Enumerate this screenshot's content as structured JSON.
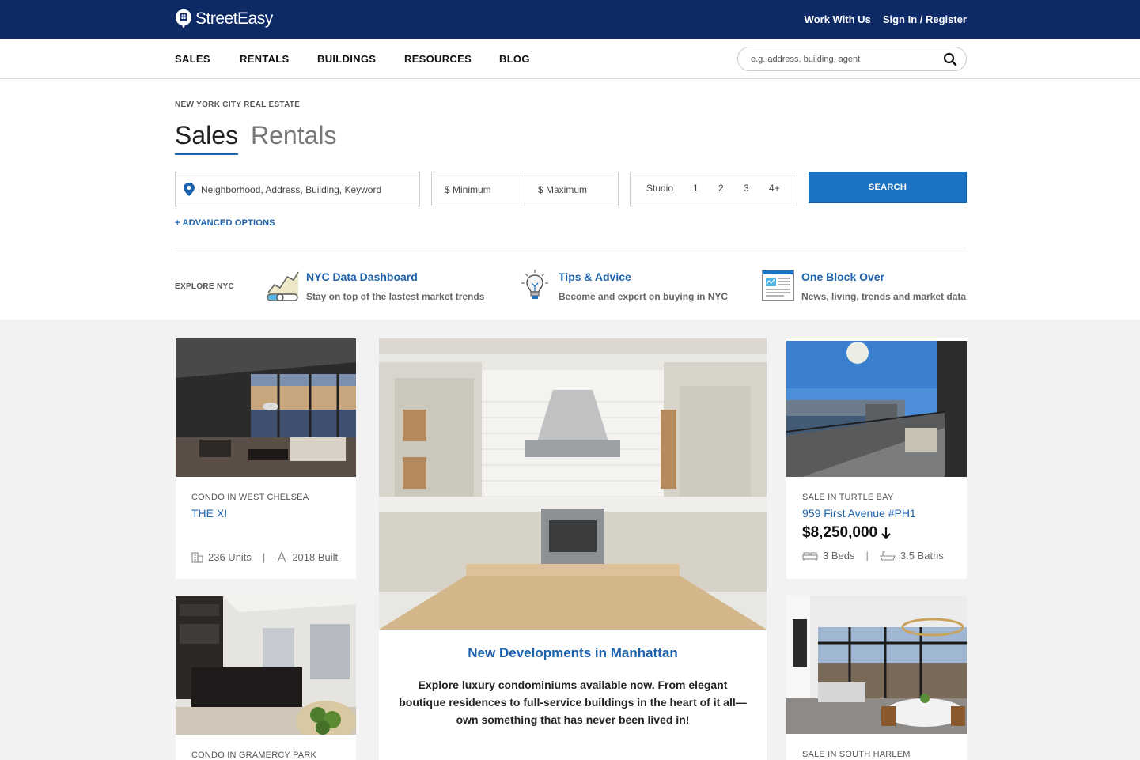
{
  "header": {
    "brand": "StreetEasy",
    "links": [
      "Work With Us",
      "Sign In / Register"
    ]
  },
  "nav": {
    "items": [
      "SALES",
      "RENTALS",
      "BUILDINGS",
      "RESOURCES",
      "BLOG"
    ],
    "search_placeholder": "e.g. address, building, agent"
  },
  "hero": {
    "eyebrow": "NEW YORK CITY REAL ESTATE",
    "tabs": [
      "Sales",
      "Rentals"
    ],
    "active_tab": "Sales",
    "location_placeholder": "Neighborhood, Address, Building, Keyword",
    "min_placeholder": "$ Minimum",
    "max_placeholder": "$ Maximum",
    "bed_options": [
      "Studio",
      "1",
      "2",
      "3",
      "4+"
    ],
    "search_label": "SEARCH",
    "advanced_label": "+ ADVANCED OPTIONS"
  },
  "explore": {
    "label": "EXPLORE NYC",
    "items": [
      {
        "title": "NYC Data Dashboard",
        "subtitle": "Stay on top of the lastest market trends",
        "icon": "chart-icon"
      },
      {
        "title": "Tips & Advice",
        "subtitle": "Become and expert on buying in NYC",
        "icon": "lightbulb-icon"
      },
      {
        "title": "One Block Over",
        "subtitle": "News, living, trends and market data",
        "icon": "newspaper-icon"
      }
    ]
  },
  "cards": {
    "xi": {
      "type": "CONDO IN WEST CHELSEA",
      "name": "THE XI",
      "units": "236 Units",
      "built": "2018 Built"
    },
    "gramercy": {
      "type": "CONDO IN GRAMERCY PARK"
    },
    "feature": {
      "title": "New Developments in Manhattan",
      "body": "Explore luxury condominiums available now. From elegant boutique residences to full-service buildings in the heart of it all—own something that has never been lived in!"
    },
    "first_ave": {
      "type": "SALE IN TURTLE BAY",
      "name": "959 First Avenue #PH1",
      "price": "$8,250,000",
      "beds": "3 Beds",
      "baths": "3.5 Baths"
    },
    "harlem": {
      "type": "SALE IN SOUTH HARLEM"
    }
  },
  "colors": {
    "navy": "#0e2a66",
    "brand_blue": "#1c62ad",
    "button_blue": "#1c73c4"
  }
}
